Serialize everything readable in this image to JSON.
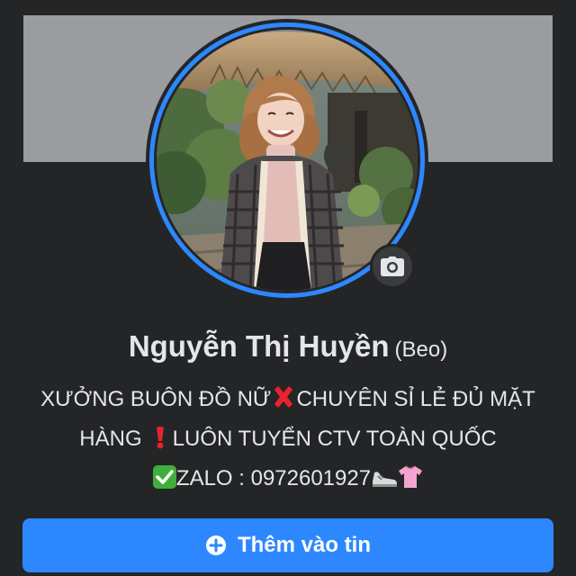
{
  "profile": {
    "name": "Nguyễn Thị Huyền",
    "alternate_name": "(Beo)"
  },
  "bio": {
    "line1_a": "XƯỞNG BUÔN ĐỒ NỮ",
    "line1_b": "CHUYÊN SỈ LẺ ĐỦ MẶT",
    "line2_a": "HÀNG",
    "line2_b": "LUÔN TUYỂN CTV TOÀN QUỐC",
    "line3": "ZALO : 0972601927"
  },
  "actions": {
    "add_story_label": "Thêm vào tin"
  },
  "icons": {
    "camera": "camera-icon",
    "plus": "plus-circle-icon",
    "cross": "cross-mark-emoji",
    "exclamation": "exclamation-emoji",
    "check": "check-mark-emoji",
    "shoe": "sneaker-emoji",
    "shirt": "shirt-emoji"
  },
  "colors": {
    "background": "#242526",
    "cover": "#9a9c9f",
    "accent": "#2d88ff",
    "text": "#e4e6eb"
  }
}
